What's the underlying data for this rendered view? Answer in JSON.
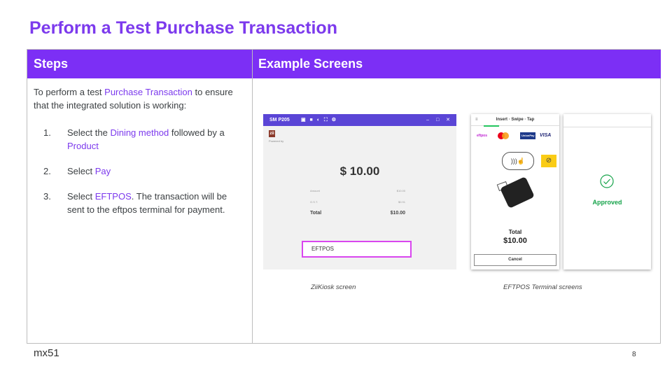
{
  "title": "Perform a Test Purchase Transaction",
  "table": {
    "col_steps": "Steps",
    "col_examples": "Example Screens"
  },
  "intro": {
    "before": "To perform a test ",
    "link": "Purchase Transaction",
    "after": " to ensure that the integrated solution is working:"
  },
  "steps": [
    {
      "num": "1.",
      "parts": [
        {
          "text": "Select the ",
          "hl": false
        },
        {
          "text": "Dining method",
          "hl": true
        },
        {
          "text": " followed by a ",
          "hl": false
        },
        {
          "text": "Product",
          "hl": true
        }
      ]
    },
    {
      "num": "2.",
      "parts": [
        {
          "text": "Select ",
          "hl": false
        },
        {
          "text": "Pay",
          "hl": true
        }
      ]
    },
    {
      "num": "3.",
      "parts": [
        {
          "text": "Select ",
          "hl": false
        },
        {
          "text": "EFTPOS",
          "hl": true
        },
        {
          "text": ". The transaction will be sent to the eftpos terminal for payment.",
          "hl": false
        }
      ]
    }
  ],
  "kiosk": {
    "window_title": "SM P205",
    "logo": "zii",
    "powered": "Powered by",
    "amount": "$ 10.00",
    "rows": [
      {
        "label": "Amount",
        "value": "$10.00"
      },
      {
        "label": "G.S.T.",
        "value": "$0.91"
      },
      {
        "label": "Total",
        "value": "$10.00"
      }
    ],
    "eftpos_button": "EFTPOS"
  },
  "terminal": {
    "header": "Insert · Swipe · Tap",
    "cards": [
      "eftpos",
      "mastercard",
      "UnionPay",
      "VISA"
    ],
    "total_label": "Total",
    "total_value": "$10.00",
    "cancel": "Cancel",
    "approved": "Approved"
  },
  "captions": {
    "kiosk": "ZiiKiosk screen",
    "terminal": "EFTPOS Terminal screens"
  },
  "footer": {
    "logo": "mx51",
    "page": "8"
  },
  "colors": {
    "accent": "#7c2ff5",
    "highlight": "#7c3aed",
    "approved": "#16a34a",
    "eftpos_border": "#d946ef"
  }
}
